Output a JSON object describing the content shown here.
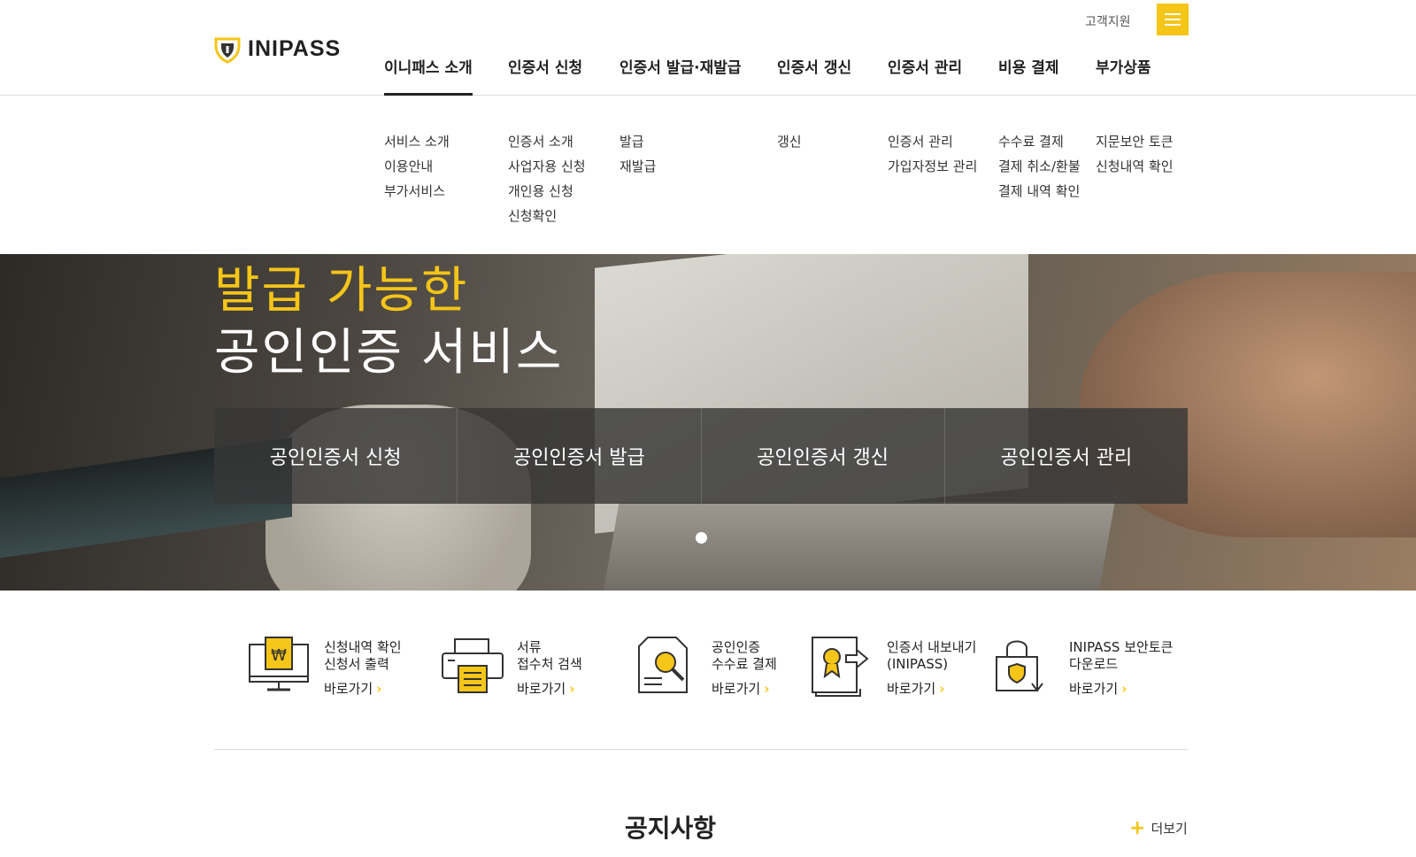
{
  "header": {
    "brand": "INIPASS",
    "support_link": "고객지원",
    "nav": [
      {
        "label": "이니패스 소개",
        "sub": [
          "서비스 소개",
          "이용안내",
          "부가서비스"
        ]
      },
      {
        "label": "인증서 신청",
        "sub": [
          "인증서 소개",
          "사업자용 신청",
          "개인용 신청",
          "신청확인"
        ]
      },
      {
        "label": "인증서 발급·재발급",
        "sub": [
          "발급",
          "재발급"
        ]
      },
      {
        "label": "인증서 갱신",
        "sub": [
          "갱신"
        ]
      },
      {
        "label": "인증서 관리",
        "sub": [
          "인증서 관리",
          "가입자정보 관리"
        ]
      },
      {
        "label": "비용 결제",
        "sub": [
          "수수료 결제",
          "결제 취소/환불",
          "결제 내역 확인"
        ]
      },
      {
        "label": "부가상품",
        "sub": [
          "지문보안 토큰",
          "신청내역 확인"
        ]
      }
    ]
  },
  "hero": {
    "title_line1": "발급 가능한",
    "title_line2": "공인인증 서비스",
    "quick_buttons": [
      "공인인증서 신청",
      "공인인증서 발급",
      "공인인증서 갱신",
      "공인인증서 관리"
    ]
  },
  "services": [
    {
      "line1": "신청내역 확인",
      "line2": "신청서 출력",
      "go": "바로가기",
      "icon": "monitor-won-icon"
    },
    {
      "line1": "서류",
      "line2": "접수처 검색",
      "go": "바로가기",
      "icon": "printer-icon"
    },
    {
      "line1": "공인인증",
      "line2": "수수료 결제",
      "go": "바로가기",
      "icon": "document-search-icon"
    },
    {
      "line1": "인증서 내보내기",
      "line2": "(INIPASS)",
      "go": "바로가기",
      "icon": "certificate-export-icon"
    },
    {
      "line1": "INIPASS 보안토큰",
      "line2": "다운로드",
      "go": "바로가기",
      "icon": "lock-download-icon"
    }
  ],
  "notice": {
    "title": "공지사항",
    "more": "더보기"
  },
  "colors": {
    "accent": "#f5c518",
    "text": "#222222"
  }
}
